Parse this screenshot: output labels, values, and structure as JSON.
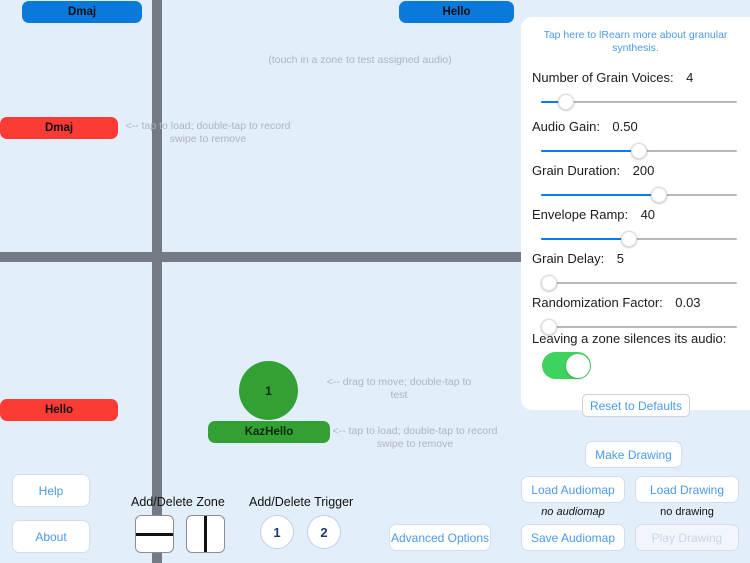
{
  "zones": {
    "hint_touch": "(touch in a zone to test assigned audio)",
    "hint_load": "<-- tap to load; double-tap to record\nswipe to remove",
    "buttons": [
      {
        "label": "Dmaj",
        "color": "#0b78dc",
        "position": "top-left"
      },
      {
        "label": "Hello",
        "color": "#0b78dc",
        "position": "top-right"
      },
      {
        "label": "Dmaj",
        "color": "#fd3b35",
        "position": "left-upper"
      },
      {
        "label": "Hello",
        "color": "#fd3b35",
        "position": "left-lower"
      }
    ]
  },
  "trigger": {
    "number": "1",
    "audio_label": "KazHello",
    "hint_drag": "<-- drag to move; double-tap to test",
    "hint_load": "<-- tap to load; double-tap to record\nswipe to remove",
    "color": "#33a033"
  },
  "advanced_panel": {
    "link_text": "Tap here to lRearn more\nabout granular synthesis.",
    "link_color": "#4a9ae8",
    "params": [
      {
        "label": "Number of Grain Voices:",
        "value": "4",
        "fill_pct": 13
      },
      {
        "label": "Audio Gain:",
        "value": "0.50",
        "fill_pct": 50
      },
      {
        "label": "Grain Duration:",
        "value": "200",
        "fill_pct": 60
      },
      {
        "label": "Envelope Ramp:",
        "value": "40",
        "fill_pct": 45
      },
      {
        "label": "Grain Delay:",
        "value": "5",
        "fill_pct": 4
      },
      {
        "label": "Randomization Factor:",
        "value": "0.03",
        "fill_pct": 3
      }
    ],
    "toggle_label": "Leaving a zone silences its audio:",
    "toggle_on": true,
    "toggle_color": "#3ed35f",
    "reset_label": "Reset to Defaults"
  },
  "controls": {
    "help_label": "Help",
    "about_label": "About",
    "advanced_label": "Advanced Options",
    "zone_label": "Add/Delete Zone",
    "trigger_label": "Add/Delete Trigger",
    "trigger_numbers": [
      "1",
      "2"
    ],
    "split_h_icon": "split-horizontal-icon",
    "split_v_icon": "split-vertical-icon"
  },
  "drawing": {
    "make_label": "Make Drawing",
    "load_audiomap_label": "Load Audiomap",
    "load_drawing_label": "Load Drawing",
    "save_audiomap_label": "Save Audiomap",
    "play_drawing_label": "Play Drawing",
    "audiomap_status": "no audiomap",
    "drawing_status": "no drawing",
    "play_enabled": false
  }
}
